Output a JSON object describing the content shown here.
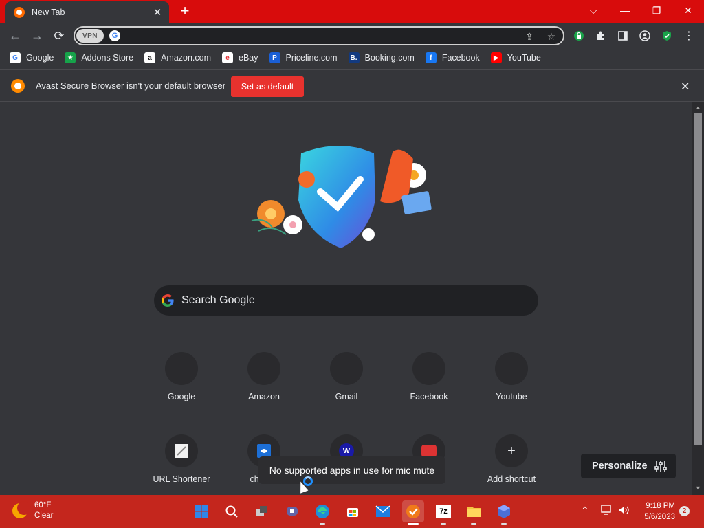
{
  "tab": {
    "title": "New Tab",
    "close": "✕",
    "new_tab": "+"
  },
  "window_controls": {
    "dropdown": "⌵",
    "minimize": "—",
    "restore": "❐",
    "close": "✕"
  },
  "toolbar": {
    "back": "←",
    "forward": "→",
    "reload": "⟳",
    "vpn_label": "VPN",
    "address_value": "",
    "share": "⇪",
    "bookmark_star": "☆"
  },
  "bookmarks": [
    {
      "label": "Google",
      "icon": "google-icon",
      "color": "#ffffff",
      "glyph": "G",
      "fg": "#4285f4"
    },
    {
      "label": "Addons Store",
      "icon": "addons-store-icon",
      "color": "#16a34a",
      "glyph": "★",
      "fg": "#ffffff"
    },
    {
      "label": "Amazon.com",
      "icon": "amazon-icon",
      "color": "#ffffff",
      "glyph": "a",
      "fg": "#111111"
    },
    {
      "label": "eBay",
      "icon": "ebay-icon",
      "color": "#ffffff",
      "glyph": "e",
      "fg": "#e53238"
    },
    {
      "label": "Priceline.com",
      "icon": "priceline-icon",
      "color": "#1a5fd6",
      "glyph": "P",
      "fg": "#ffffff"
    },
    {
      "label": "Booking.com",
      "icon": "booking-icon",
      "color": "#123a80",
      "glyph": "B.",
      "fg": "#ffffff"
    },
    {
      "label": "Facebook",
      "icon": "facebook-icon",
      "color": "#1877f2",
      "glyph": "f",
      "fg": "#ffffff"
    },
    {
      "label": "YouTube",
      "icon": "youtube-icon",
      "color": "#ff0000",
      "glyph": "▶",
      "fg": "#ffffff"
    }
  ],
  "infobar": {
    "message": "Avast Secure Browser isn't your default browser",
    "button": "Set as default",
    "close": "✕"
  },
  "search": {
    "placeholder": "Search Google"
  },
  "shortcuts_row1": [
    {
      "label": "Google"
    },
    {
      "label": "Amazon"
    },
    {
      "label": "Gmail"
    },
    {
      "label": "Facebook"
    },
    {
      "label": "Youtube"
    }
  ],
  "shortcuts_row2": [
    {
      "label": "URL Shortener"
    },
    {
      "label": "channe"
    },
    {
      "label": ""
    },
    {
      "label": ""
    },
    {
      "label": "Add shortcut"
    }
  ],
  "toast": {
    "text": "No supported apps in use for mic mute"
  },
  "personalize": {
    "label": "Personalize"
  },
  "taskbar": {
    "weather_temp": "60°F",
    "weather_desc": "Clear",
    "time": "9:18 PM",
    "date": "5/6/2023",
    "notification_count": "2"
  },
  "colors": {
    "accent_red": "#d80c0c",
    "taskbar": "#c4261d",
    "button_red": "#e8322e"
  }
}
